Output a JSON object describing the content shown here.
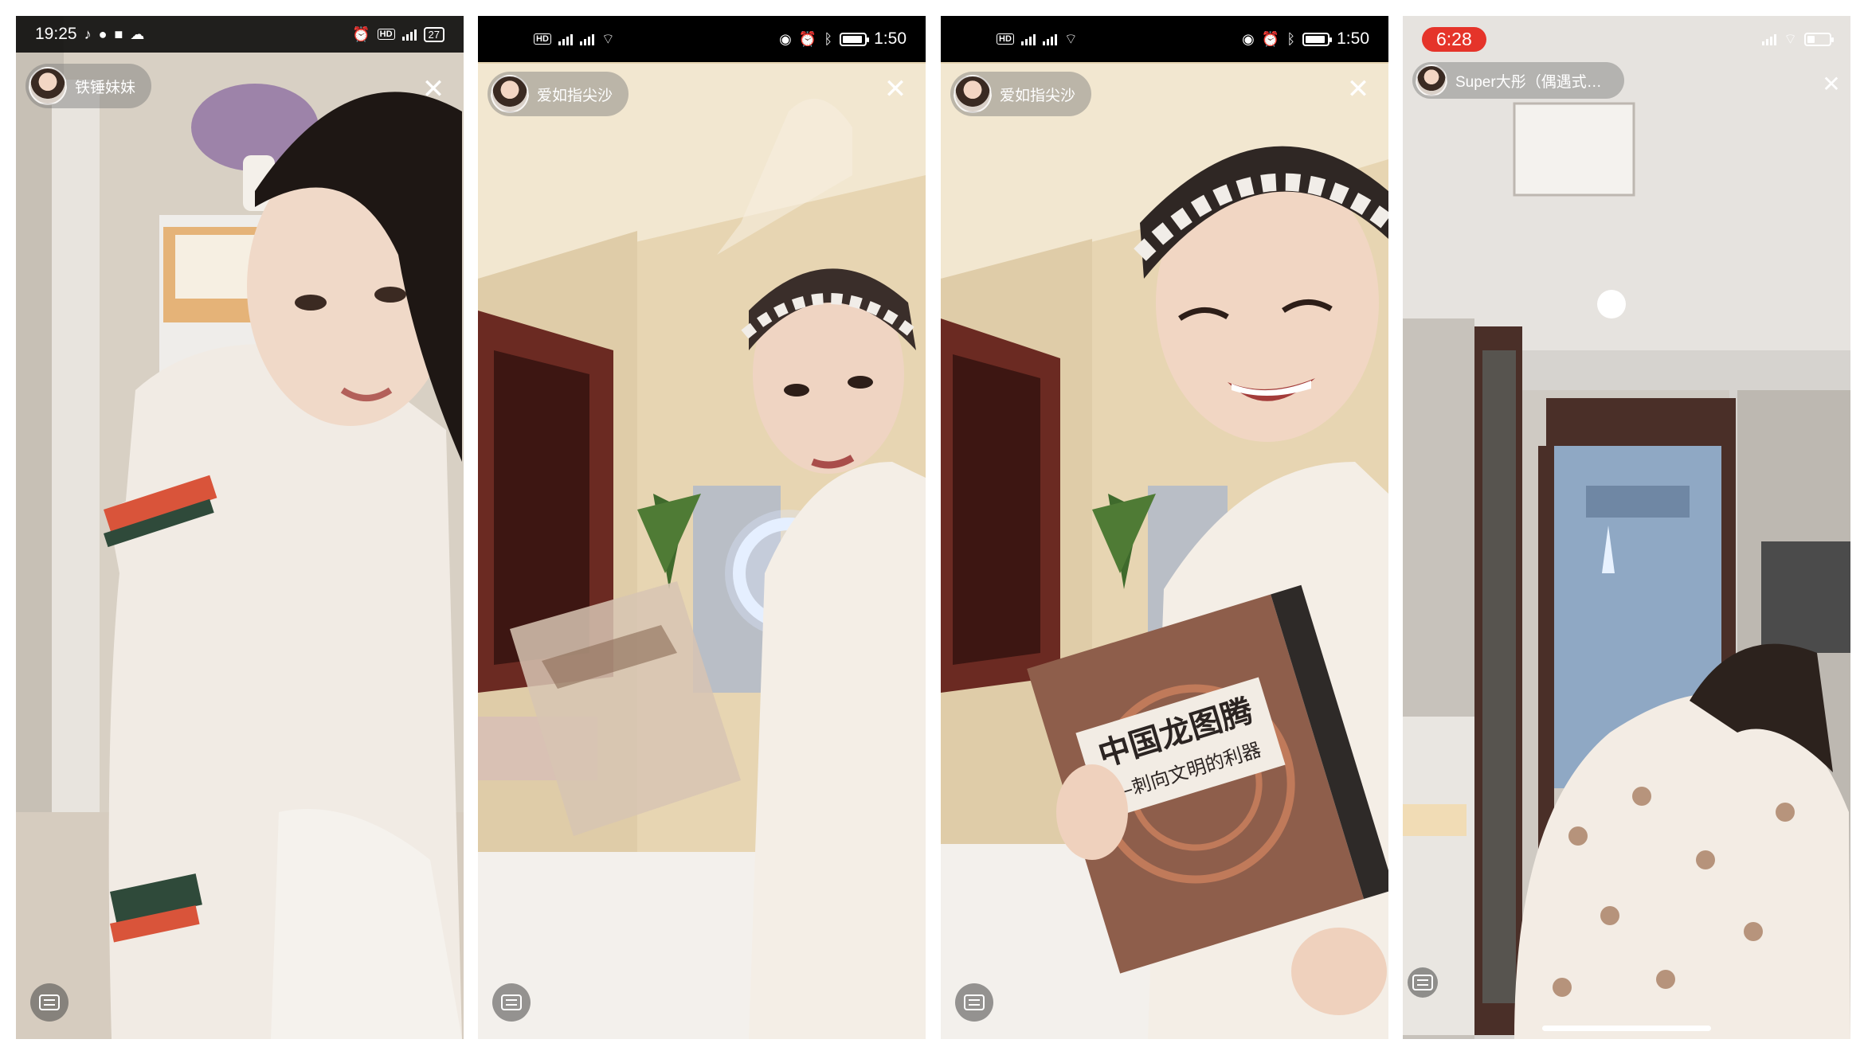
{
  "panels": [
    {
      "status": {
        "time": "19:25",
        "battery": "27"
      },
      "streamer": {
        "name": "铁锤妹妹"
      },
      "close_glyph": "✕",
      "colors": {
        "bg": "#cfc6ba",
        "outfit": "#f1ebe4",
        "armband_red": "#d9543a",
        "armband_green": "#2f4a3a"
      }
    },
    {
      "status": {
        "time": "1:50"
      },
      "streamer": {
        "name": "爱如指尖沙"
      },
      "close_glyph": "✕",
      "colors": {
        "wall": "#e7d5b2",
        "door": "#6b2a22",
        "ring_light": "#eaf3ff"
      }
    },
    {
      "status": {
        "time": "1:50"
      },
      "streamer": {
        "name": "爱如指尖沙"
      },
      "close_glyph": "✕",
      "book": {
        "title": "中国龙图腾",
        "subtitle": "—刺向文明的利器"
      },
      "colors": {
        "book": "#8e5e4b",
        "book_spine": "#2e2a28"
      }
    },
    {
      "status": {
        "time": "6:28"
      },
      "streamer": {
        "name": "Super大彤（偶遇式…"
      },
      "close_glyph": "✕",
      "colors": {
        "time_pill": "#e5342a",
        "wall": "#d6d3cf",
        "doorframe": "#4a2f28",
        "room_light": "#8fa8c4"
      }
    }
  ]
}
